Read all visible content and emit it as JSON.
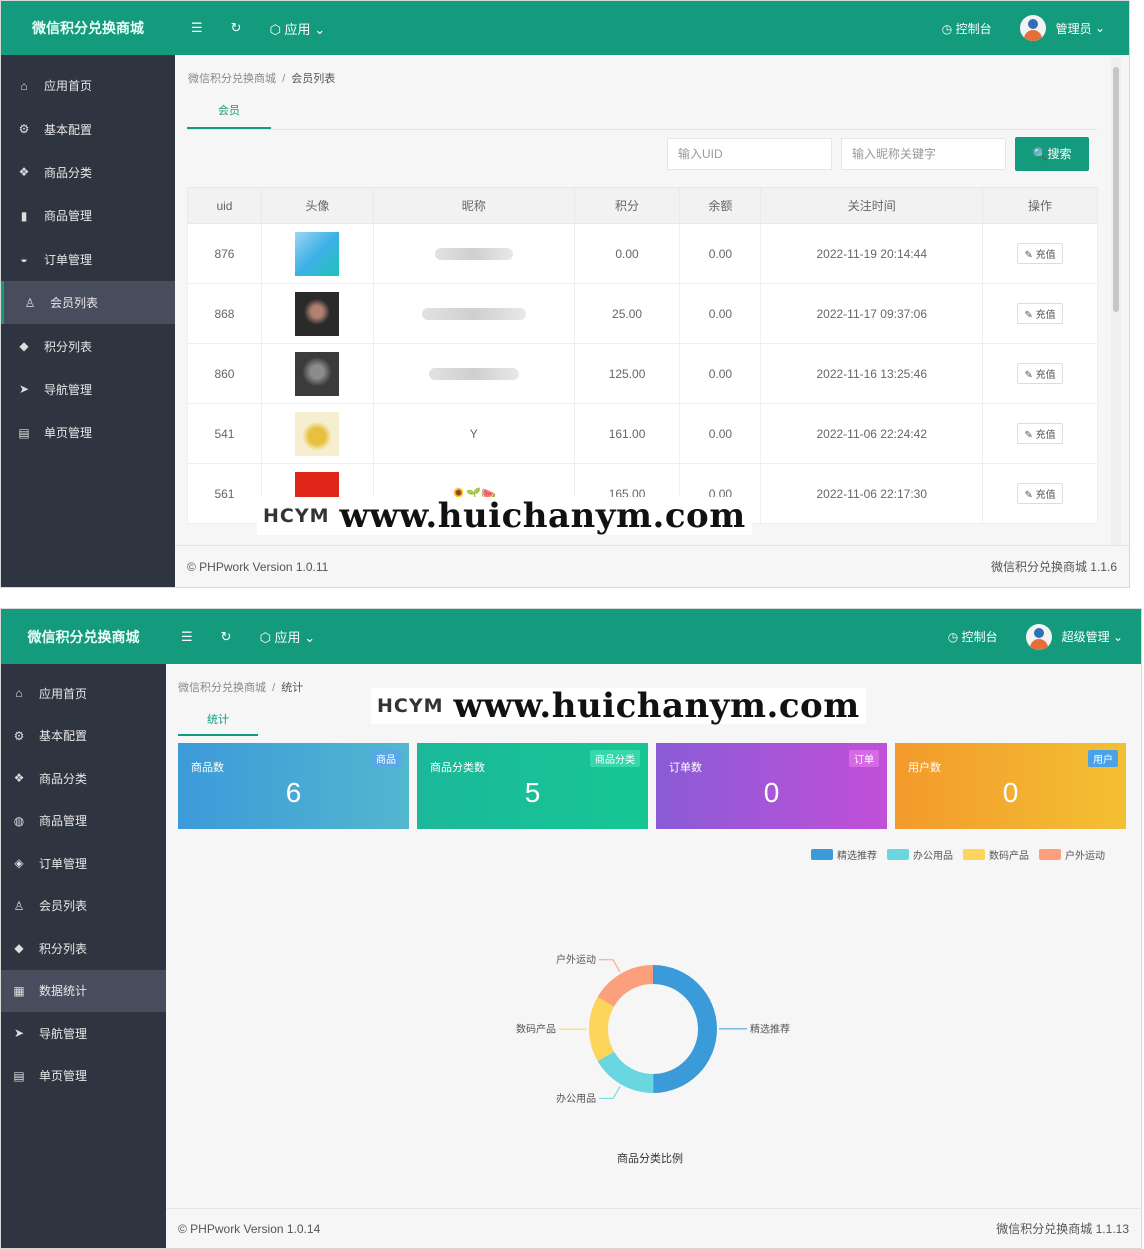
{
  "shot1": {
    "brand": "微信积分兑换商城",
    "topbar": {
      "apps_label": "应用",
      "console_label": "控制台",
      "user_label": "管理员"
    },
    "sidebar": [
      {
        "label": "应用首页",
        "icon": "home-icon"
      },
      {
        "label": "基本配置",
        "icon": "gear-icon"
      },
      {
        "label": "商品分类",
        "icon": "cubes-icon"
      },
      {
        "label": "商品管理",
        "icon": "bag-icon"
      },
      {
        "label": "订单管理",
        "icon": "basket-icon"
      },
      {
        "label": "会员列表",
        "icon": "user-icon"
      },
      {
        "label": "积分列表",
        "icon": "diamond-icon"
      },
      {
        "label": "导航管理",
        "icon": "send-icon"
      },
      {
        "label": "单页管理",
        "icon": "file-icon"
      }
    ],
    "active_index": 5,
    "breadcrumb": {
      "root": "微信积分兑换商城",
      "current": "会员列表"
    },
    "tab": "会员",
    "search": {
      "uid_placeholder": "输入UID",
      "keyword_placeholder": "输入昵称关键字",
      "button": "搜索"
    },
    "table": {
      "headers": [
        "uid",
        "头像",
        "昵称",
        "积分",
        "余额",
        "关注时间",
        "操作"
      ],
      "rows": [
        {
          "uid": "876",
          "nickname": "",
          "points": "0.00",
          "balance": "0.00",
          "time": "2022-11-19 20:14:44",
          "action": "充值"
        },
        {
          "uid": "868",
          "nickname": "",
          "points": "25.00",
          "balance": "0.00",
          "time": "2022-11-17 09:37:06",
          "action": "充值"
        },
        {
          "uid": "860",
          "nickname": "",
          "points": "125.00",
          "balance": "0.00",
          "time": "2022-11-16 13:25:46",
          "action": "充值"
        },
        {
          "uid": "541",
          "nickname": "Y",
          "points": "161.00",
          "balance": "0.00",
          "time": "2022-11-06 22:24:42",
          "action": "充值"
        },
        {
          "uid": "561",
          "nickname": "🌻🌱🍉",
          "points": "165.00",
          "balance": "0.00",
          "time": "2022-11-06 22:17:30",
          "action": "充值"
        }
      ]
    },
    "footer": {
      "left": "© PHPwork Version 1.0.11",
      "right": "微信积分兑换商城 1.1.6"
    },
    "watermark": {
      "logo": "HCYM",
      "url": "www.huichanym.com"
    }
  },
  "shot2": {
    "brand": "微信积分兑换商城",
    "topbar": {
      "apps_label": "应用",
      "console_label": "控制台",
      "user_label": "超级管理"
    },
    "sidebar": [
      {
        "label": "应用首页",
        "icon": "home-icon"
      },
      {
        "label": "基本配置",
        "icon": "gear-icon"
      },
      {
        "label": "商品分类",
        "icon": "cubes-icon"
      },
      {
        "label": "商品管理",
        "icon": "box-icon"
      },
      {
        "label": "订单管理",
        "icon": "layers-icon"
      },
      {
        "label": "会员列表",
        "icon": "user-icon"
      },
      {
        "label": "积分列表",
        "icon": "diamond-icon"
      },
      {
        "label": "数据统计",
        "icon": "chart-icon"
      },
      {
        "label": "导航管理",
        "icon": "send-icon"
      },
      {
        "label": "单页管理",
        "icon": "file-icon"
      }
    ],
    "active_index": 7,
    "breadcrumb": {
      "root": "微信积分兑换商城",
      "current": "统计"
    },
    "tab": "统计",
    "cards": [
      {
        "title": "商品数",
        "badge": "商品",
        "value": "6"
      },
      {
        "title": "商品分类数",
        "badge": "商品分类",
        "value": "5"
      },
      {
        "title": "订单数",
        "badge": "订单",
        "value": "0"
      },
      {
        "title": "用户数",
        "badge": "用户",
        "value": "0"
      }
    ],
    "footer": {
      "left": "© PHPwork Version 1.0.14",
      "right": "微信积分兑换商城 1.1.13"
    },
    "watermark": {
      "logo": "HCYM",
      "url": "www.huichanym.com"
    },
    "chart_data": {
      "type": "pie",
      "title": "商品分类比例",
      "categories": [
        "精选推荐",
        "办公用品",
        "数码产品",
        "户外运动"
      ],
      "values": [
        50,
        16.7,
        16.7,
        16.7
      ],
      "colors": [
        "#3a9bd8",
        "#6ad6e0",
        "#fcd55a",
        "#fb9f7c"
      ],
      "legend_position": "top-right"
    }
  }
}
